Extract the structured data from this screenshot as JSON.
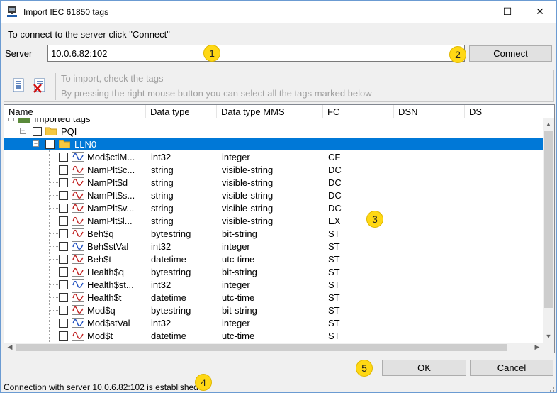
{
  "window": {
    "title": "Import IEC 61850 tags",
    "minimize_glyph": "—",
    "maximize_glyph": "☐",
    "close_glyph": "✕"
  },
  "connect": {
    "hint": "To connect to the server click \"Connect\"",
    "server_label": "Server",
    "server_value": "10.0.6.82:102",
    "connect_label": "Connect"
  },
  "toolbar": {
    "hint_line1": "To import, check the tags",
    "hint_line2": "By pressing the right mouse button you can select all the tags marked below",
    "check_icon": "check-list-icon",
    "uncheck_icon": "uncheck-list-icon"
  },
  "grid": {
    "columns": [
      "Name",
      "Data type",
      "Data type MMS",
      "FC",
      "DSN",
      "DS"
    ],
    "root_label": "Imported tags",
    "folder_label": "PQI",
    "node_label": "LLN0",
    "rows": [
      {
        "name": "Mod$ctlM...",
        "dt": "int32",
        "mms": "integer",
        "fc": "CF"
      },
      {
        "name": "NamPlt$c...",
        "dt": "string",
        "mms": "visible-string",
        "fc": "DC"
      },
      {
        "name": "NamPlt$d",
        "dt": "string",
        "mms": "visible-string",
        "fc": "DC"
      },
      {
        "name": "NamPlt$s...",
        "dt": "string",
        "mms": "visible-string",
        "fc": "DC"
      },
      {
        "name": "NamPlt$v...",
        "dt": "string",
        "mms": "visible-string",
        "fc": "DC"
      },
      {
        "name": "NamPlt$l...",
        "dt": "string",
        "mms": "visible-string",
        "fc": "EX"
      },
      {
        "name": "Beh$q",
        "dt": "bytestring",
        "mms": "bit-string",
        "fc": "ST"
      },
      {
        "name": "Beh$stVal",
        "dt": "int32",
        "mms": "integer",
        "fc": "ST"
      },
      {
        "name": "Beh$t",
        "dt": "datetime",
        "mms": "utc-time",
        "fc": "ST"
      },
      {
        "name": "Health$q",
        "dt": "bytestring",
        "mms": "bit-string",
        "fc": "ST"
      },
      {
        "name": "Health$st...",
        "dt": "int32",
        "mms": "integer",
        "fc": "ST"
      },
      {
        "name": "Health$t",
        "dt": "datetime",
        "mms": "utc-time",
        "fc": "ST"
      },
      {
        "name": "Mod$q",
        "dt": "bytestring",
        "mms": "bit-string",
        "fc": "ST"
      },
      {
        "name": "Mod$stVal",
        "dt": "int32",
        "mms": "integer",
        "fc": "ST"
      },
      {
        "name": "Mod$t",
        "dt": "datetime",
        "mms": "utc-time",
        "fc": "ST"
      }
    ]
  },
  "buttons": {
    "ok_label": "OK",
    "cancel_label": "Cancel"
  },
  "status": {
    "text": "Connection with server 10.0.6.82:102 is established"
  },
  "badges": [
    "1",
    "2",
    "3",
    "4",
    "5"
  ],
  "colors": {
    "selection": "#0078d7",
    "badge": "#ffd814"
  }
}
